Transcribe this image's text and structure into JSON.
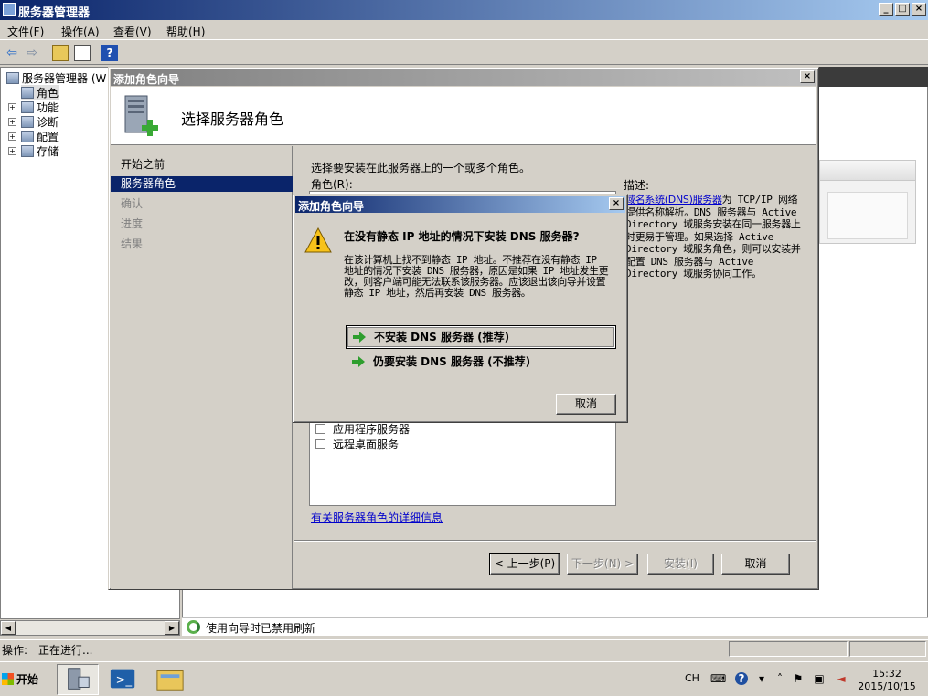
{
  "window": {
    "title": "服务器管理器"
  },
  "menu": [
    "文件(F)",
    "操作(A)",
    "查看(V)",
    "帮助(H)"
  ],
  "tree": {
    "root": "服务器管理器 (W",
    "items": [
      "角色",
      "功能",
      "诊断",
      "配置",
      "存储"
    ]
  },
  "right_status": "使用向导时已禁用刷新",
  "statusbar": {
    "label": "操作:",
    "value": "正在进行..."
  },
  "wizard": {
    "title": "添加角色向导",
    "heading": "选择服务器角色",
    "nav": [
      "开始之前",
      "服务器角色",
      "确认",
      "进度",
      "结果"
    ],
    "intro": "选择要安装在此服务器上的一个或多个角色。",
    "roles_label": "角色(R):",
    "roles_visible": [
      "应用程序服务器",
      "远程桌面服务"
    ],
    "desc_label": "描述:",
    "desc_link": "域名系统(DNS)服务器",
    "desc_text": "为 TCP/IP 网络提供名称解析。DNS 服务器与 Active Directory 域服务安装在同一服务器上时更易于管理。如果选择 Active Directory 域服务角色，则可以安装并配置 DNS 服务器与 Active Directory 域服务协同工作。",
    "more_link": "有关服务器角色的详细信息",
    "buttons": {
      "prev": "< 上一步(P)",
      "next": "下一步(N) >",
      "install": "安装(I)",
      "cancel": "取消"
    }
  },
  "dialog": {
    "title": "添加角色向导",
    "heading": "在没有静态 IP 地址的情况下安装 DNS 服务器?",
    "body": "在该计算机上找不到静态 IP 地址。不推荐在没有静态 IP 地址的情况下安装 DNS 服务器，原因是如果 IP 地址发生更改，则客户端可能无法联系该服务器。应该退出该向导并设置静态 IP 地址，然后再安装 DNS 服务器。",
    "option1": "不安装 DNS 服务器 (推荐)",
    "option2": "仍要安装 DNS 服务器 (不推荐)",
    "cancel": "取消"
  },
  "taskbar": {
    "start": "开始",
    "lang": "CH",
    "time": "15:32",
    "date": "2015/10/15"
  },
  "colors": {
    "selection": "#0a246a",
    "link": "#0000cc",
    "face": "#d4d0c8"
  }
}
